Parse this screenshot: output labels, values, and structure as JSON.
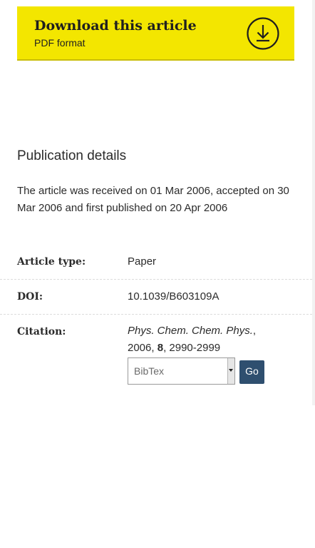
{
  "download": {
    "title": "Download this article",
    "subtitle": "PDF format",
    "icon": "download-arrow-icon"
  },
  "publication": {
    "heading": "Publication details",
    "text": "The article was received on 01 Mar 2006, accepted on 30 Mar 2006 and first published on 20 Apr 2006"
  },
  "details": {
    "article_type_label": "Article type:",
    "article_type_value": "Paper",
    "doi_label": "DOI:",
    "doi_value": "10.1039/B603109A",
    "citation_label": "Citation:",
    "citation_journal": "Phys. Chem. Chem. Phys.",
    "citation_comma": ",",
    "citation_year": "2006, ",
    "citation_volume": "8",
    "citation_pages": ", 2990-2999"
  },
  "citation_export": {
    "selected_format": "BibTex",
    "go_label": "Go"
  },
  "colors": {
    "download_bg": "#f3e600",
    "go_button_bg": "#2f4f6f"
  }
}
